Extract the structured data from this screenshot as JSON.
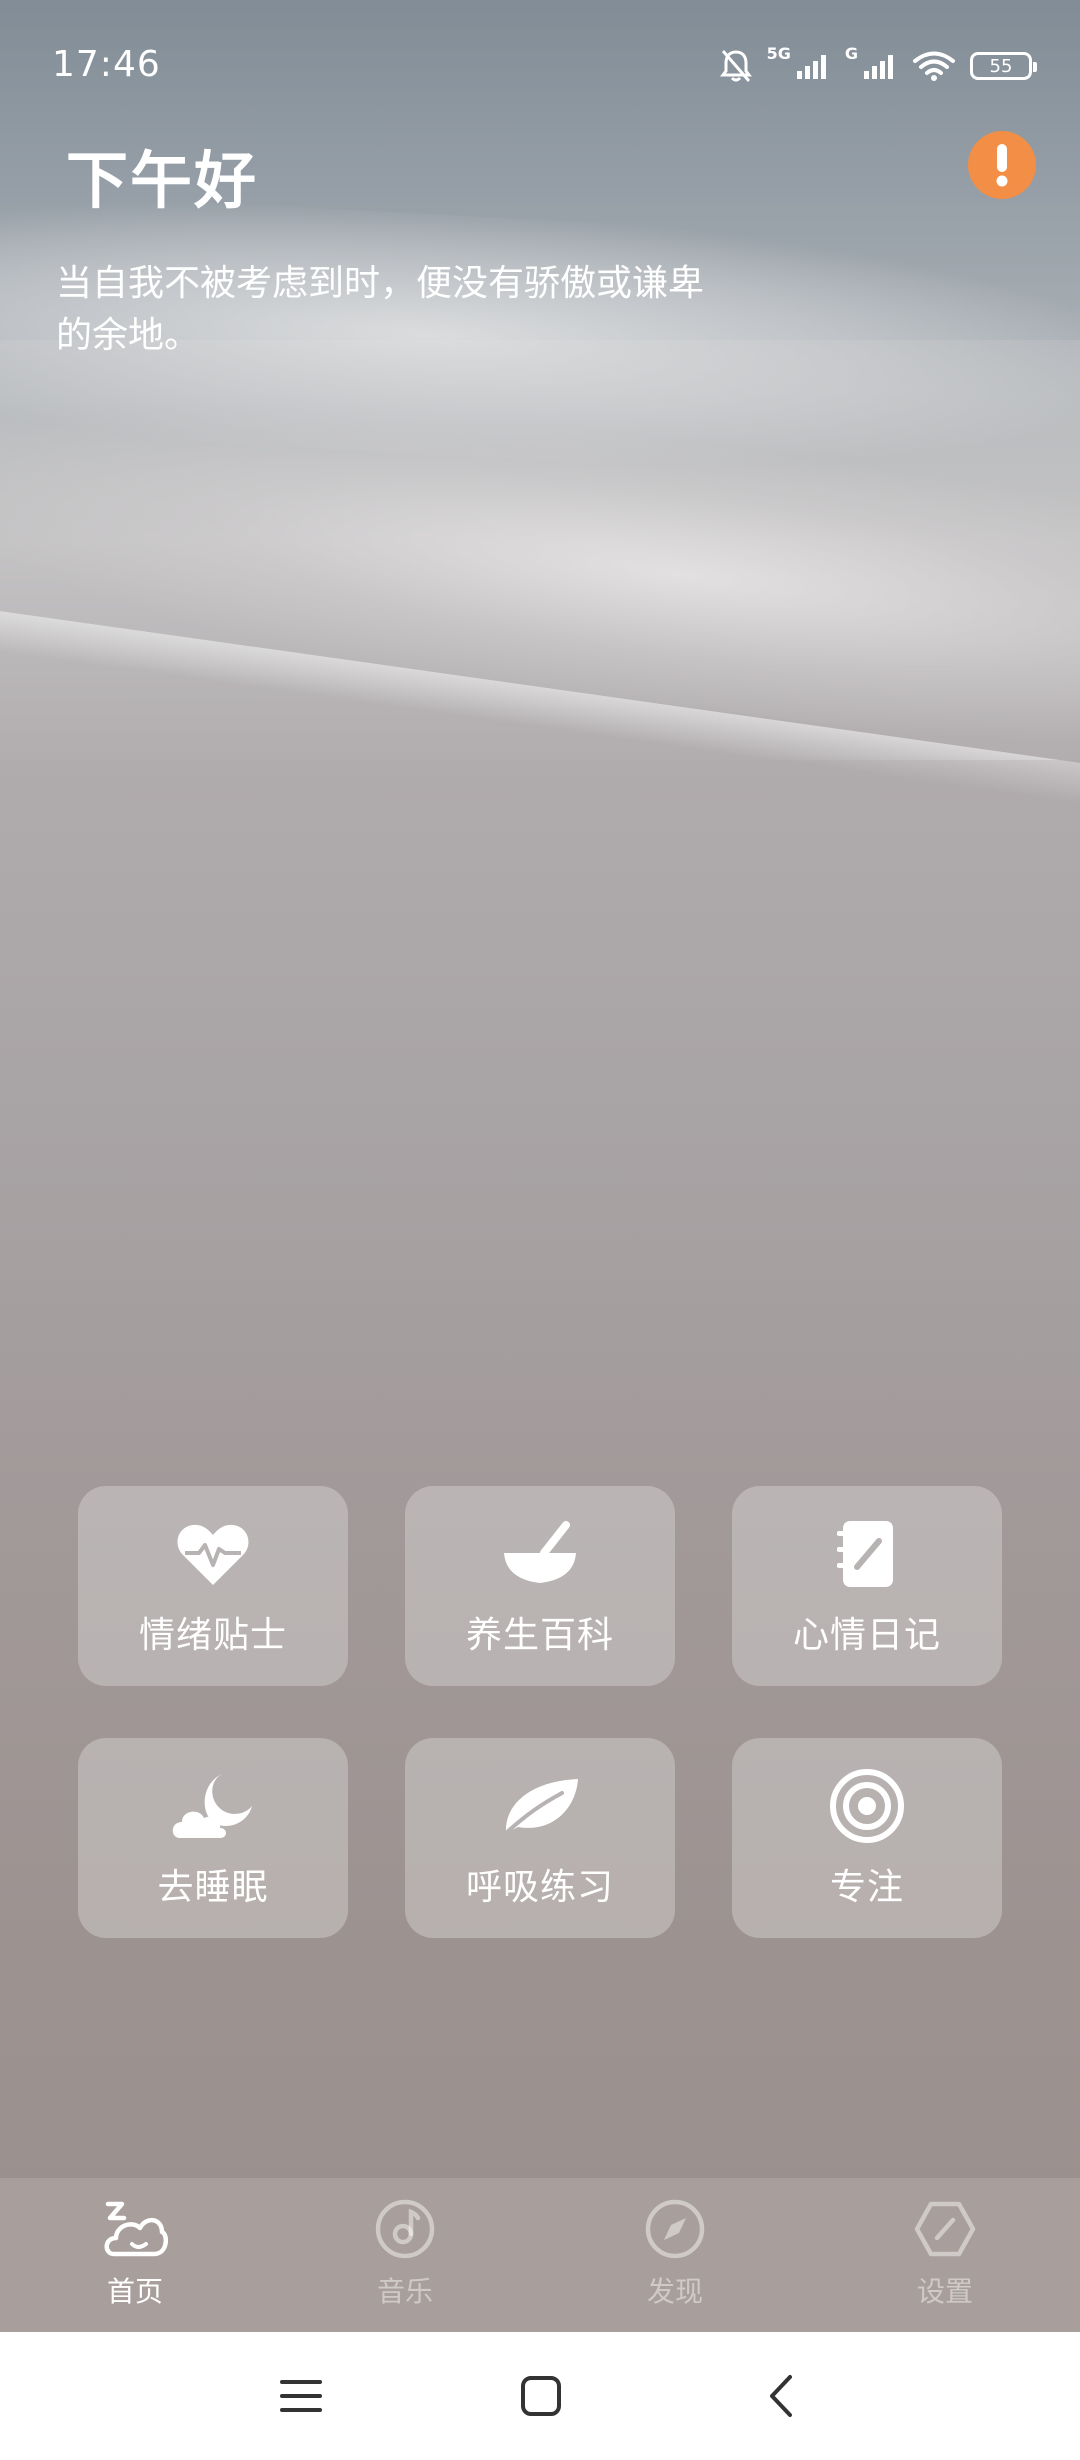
{
  "status_bar": {
    "time": "17:46",
    "network_1": "5G",
    "network_2": "G",
    "battery": "55",
    "icons": [
      "bell-muted-icon",
      "signal-icon",
      "signal-icon",
      "wifi-icon",
      "battery-icon"
    ]
  },
  "header": {
    "greeting": "下午好",
    "quote": "当自我不被考虑到时，便没有骄傲或谦卑的余地。",
    "alert_icon": "exclamation-icon",
    "alert_color": "#f28e45"
  },
  "features": [
    {
      "label": "情绪贴士",
      "icon": "heart-pulse-icon"
    },
    {
      "label": "养生百科",
      "icon": "mortar-bowl-icon"
    },
    {
      "label": "心情日记",
      "icon": "notebook-pen-icon"
    },
    {
      "label": "去睡眠",
      "icon": "moon-cloud-icon"
    },
    {
      "label": "呼吸练习",
      "icon": "leaf-icon"
    },
    {
      "label": "专注",
      "icon": "target-icon"
    }
  ],
  "bottom_nav": [
    {
      "label": "首页",
      "icon": "home-moon-icon",
      "active": true
    },
    {
      "label": "音乐",
      "icon": "music-disc-icon",
      "active": false
    },
    {
      "label": "发现",
      "icon": "compass-icon",
      "active": false
    },
    {
      "label": "设置",
      "icon": "hexagon-settings-icon",
      "active": false
    }
  ],
  "system_nav": [
    "menu-icon",
    "home-square-icon",
    "back-icon"
  ]
}
